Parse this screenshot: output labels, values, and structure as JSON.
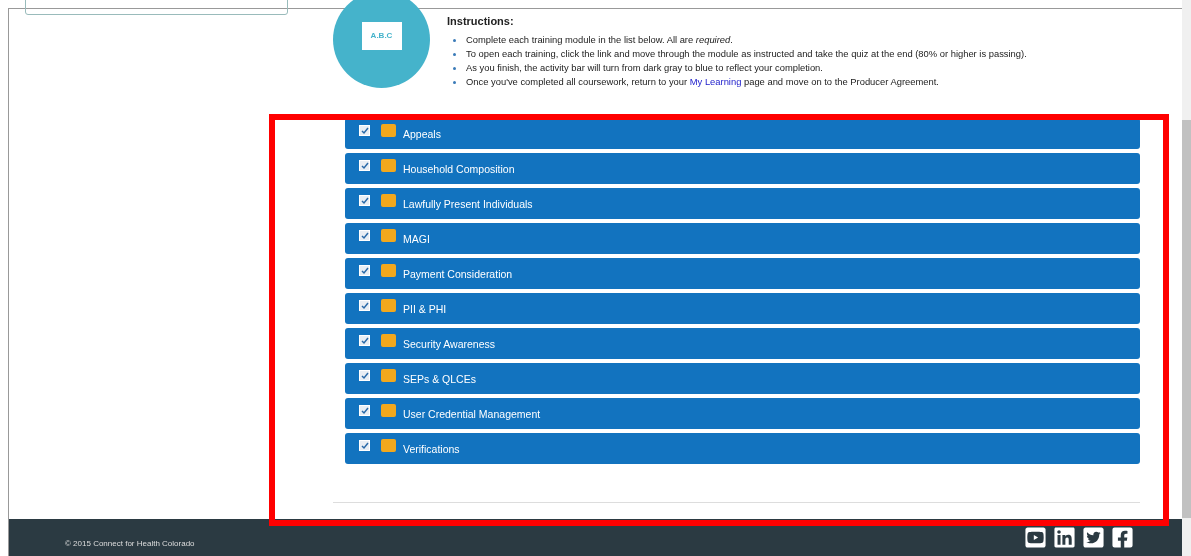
{
  "logo": {
    "board_text": "A.B.C"
  },
  "instructions": {
    "heading": "Instructions:",
    "items": [
      "Complete each training module in the list below. All are *required*.",
      "To open each training, click the link and move through the module as instructed and take the quiz at the end (80% or higher is passing).",
      "As you finish, the activity bar will turn from dark gray to blue to reflect your completion.",
      {
        "before": "Once you've completed all coursework, return to your ",
        "link": "My Learning",
        "after": " page and move on to the Producer Agreement."
      }
    ]
  },
  "modules": [
    {
      "label": "Appeals",
      "checked": true
    },
    {
      "label": "Household Composition",
      "checked": true
    },
    {
      "label": "Lawfully Present Individuals",
      "checked": true
    },
    {
      "label": "MAGI",
      "checked": true
    },
    {
      "label": "Payment Consideration",
      "checked": true
    },
    {
      "label": "PII & PHI",
      "checked": true
    },
    {
      "label": "Security Awareness",
      "checked": true
    },
    {
      "label": "SEPs & QLCEs",
      "checked": true
    },
    {
      "label": "User Credential Management",
      "checked": true
    },
    {
      "label": "Verifications",
      "checked": true
    }
  ],
  "footer": {
    "copyright": "© 2015 Connect for Health Colorado"
  }
}
